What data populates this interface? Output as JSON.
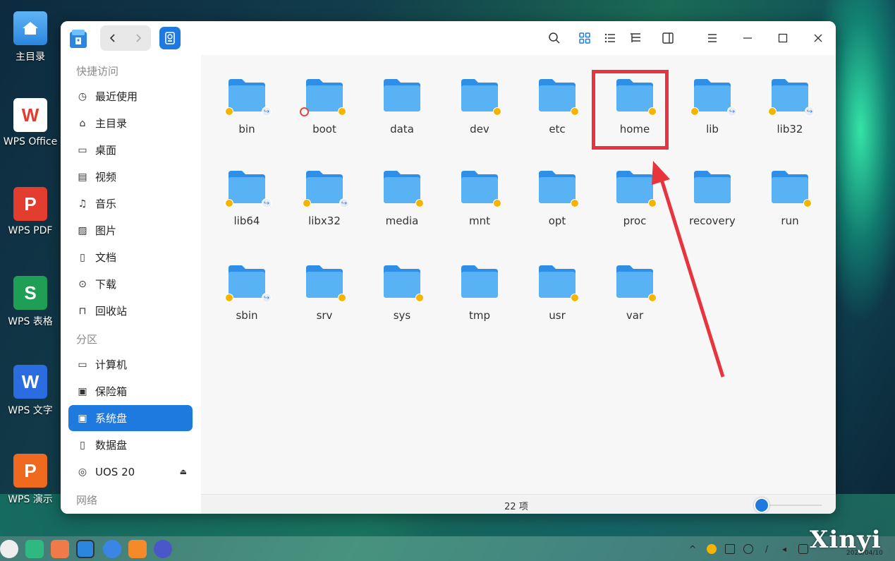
{
  "desktop": {
    "icons": [
      {
        "label": "主目录"
      },
      {
        "label": "WPS Office",
        "glyph": "W",
        "color": "#e33d2f"
      },
      {
        "label": "WPS PDF",
        "glyph": "P",
        "color": "#e33d2f"
      },
      {
        "label": "WPS 表格",
        "glyph": "S",
        "color": "#1f9e55"
      },
      {
        "label": "WPS 文字",
        "glyph": "W",
        "color": "#2b6ce0"
      },
      {
        "label": "WPS 演示",
        "glyph": "P",
        "color": "#ef6a1f"
      }
    ]
  },
  "window": {
    "nav": {
      "back_icon": "chevron-left-icon",
      "forward_icon": "chevron-right-icon"
    },
    "sidebar": {
      "quick_access_heading": "快捷访问",
      "quick_access": [
        {
          "label": "最近使用",
          "icon": "clock-icon"
        },
        {
          "label": "主目录",
          "icon": "home-icon"
        },
        {
          "label": "桌面",
          "icon": "desktop-icon"
        },
        {
          "label": "视频",
          "icon": "video-icon"
        },
        {
          "label": "音乐",
          "icon": "music-icon"
        },
        {
          "label": "图片",
          "icon": "image-icon"
        },
        {
          "label": "文档",
          "icon": "document-icon"
        },
        {
          "label": "下载",
          "icon": "download-icon"
        },
        {
          "label": "回收站",
          "icon": "trash-icon"
        }
      ],
      "partitions_heading": "分区",
      "partitions": [
        {
          "label": "计算机",
          "icon": "computer-icon"
        },
        {
          "label": "保险箱",
          "icon": "vault-icon"
        },
        {
          "label": "系统盘",
          "icon": "system-disk-icon",
          "active": true
        },
        {
          "label": "数据盘",
          "icon": "disk-icon"
        },
        {
          "label": "UOS 20",
          "icon": "optical-disc-icon"
        }
      ],
      "network_heading": "网络"
    },
    "files": [
      {
        "name": "bin",
        "lock": true,
        "link": true
      },
      {
        "name": "boot",
        "lock": true,
        "noaccess": true
      },
      {
        "name": "data"
      },
      {
        "name": "dev",
        "lock": true
      },
      {
        "name": "etc",
        "lock": true
      },
      {
        "name": "home",
        "lock": true
      },
      {
        "name": "lib",
        "lock": true,
        "link": true
      },
      {
        "name": "lib32",
        "lock": true,
        "link": true
      },
      {
        "name": "lib64",
        "lock": true,
        "link": true
      },
      {
        "name": "libx32",
        "lock": true,
        "link": true
      },
      {
        "name": "media",
        "lock": true
      },
      {
        "name": "mnt",
        "lock": true
      },
      {
        "name": "opt",
        "lock": true
      },
      {
        "name": "proc",
        "lock": true
      },
      {
        "name": "recovery"
      },
      {
        "name": "run",
        "lock": true
      },
      {
        "name": "sbin",
        "lock": true,
        "link": true
      },
      {
        "name": "srv",
        "lock": true
      },
      {
        "name": "sys",
        "lock": true
      },
      {
        "name": "tmp"
      },
      {
        "name": "usr",
        "lock": true
      },
      {
        "name": "var",
        "lock": true
      }
    ],
    "status": {
      "item_count": "22 项",
      "icon_size_fraction": 0.05
    }
  },
  "watermark": "Xinyi",
  "clock_partial": "2023/04/10",
  "colors": {
    "accent": "#1f7ae0",
    "folder": "#4aa8f0",
    "highlight": "#e8343c",
    "lock": "#f5b400"
  }
}
